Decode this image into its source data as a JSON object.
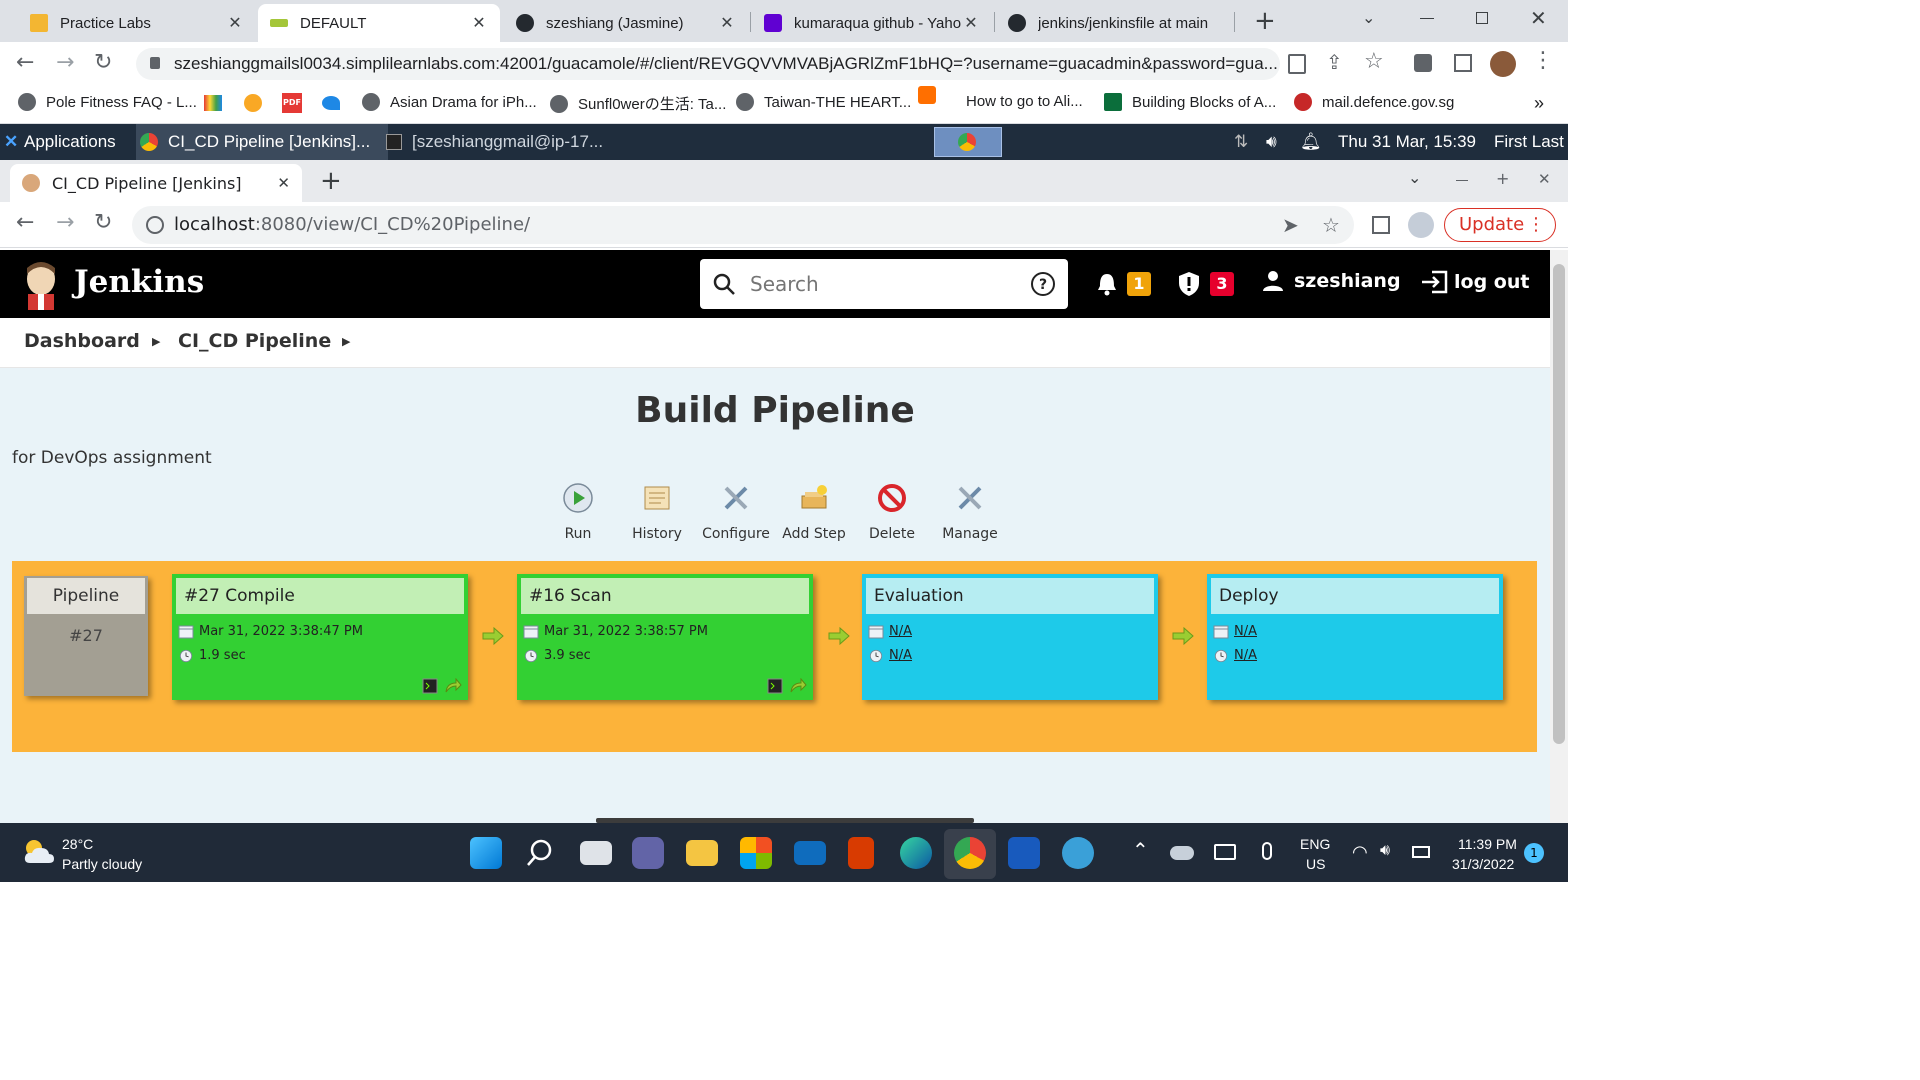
{
  "outer_browser": {
    "tabs": [
      {
        "label": "Practice Labs",
        "active": false
      },
      {
        "label": "DEFAULT",
        "active": true
      },
      {
        "label": "szeshiang (Jasmine)",
        "active": false
      },
      {
        "label": "kumaraqua github - Yaho",
        "active": false
      },
      {
        "label": "jenkins/jenkinsfile at main",
        "active": false
      }
    ],
    "new_tab": "+",
    "close": "✕",
    "url": "szeshianggmailsl0034.simplilearnlabs.com:42001/guacamole/#/client/REVGQVVMVABjAGRlZmF1bHQ=?username=guacadmin&password=gua...",
    "bookmarks": [
      "Pole Fitness FAQ - L...",
      "Asian Drama for iPh...",
      "Sunfl0werの生活: Ta...",
      "Taiwan-THE HEART...",
      "How to go to Ali...",
      "Building Blocks of A...",
      "mail.defence.gov.sg"
    ],
    "bookmarks_more": "»"
  },
  "remote_desktop": {
    "applications": "Applications",
    "task1": "CI_CD Pipeline [Jenkins]...",
    "task2": "[szeshianggmail@ip-17...",
    "clock": "Thu 31 Mar, 15:39",
    "user": "First Last"
  },
  "inner_browser": {
    "tab_title": "CI_CD Pipeline [Jenkins]",
    "url_host": "localhost",
    "url_path": ":8080/view/CI_CD%20Pipeline/",
    "update_label": "Update"
  },
  "jenkins": {
    "title": "Jenkins",
    "search_placeholder": "Search",
    "notifications_count": "1",
    "security_count": "3",
    "username": "szeshiang",
    "logout": "log out",
    "breadcrumb": [
      "Dashboard",
      "CI_CD Pipeline"
    ],
    "page_title": "Build Pipeline",
    "description": "for DevOps assignment",
    "tools": [
      {
        "label": "Run",
        "icon": "run-icon"
      },
      {
        "label": "History",
        "icon": "history-icon"
      },
      {
        "label": "Configure",
        "icon": "configure-icon"
      },
      {
        "label": "Add Step",
        "icon": "add-step-icon"
      },
      {
        "label": "Delete",
        "icon": "delete-icon"
      },
      {
        "label": "Manage",
        "icon": "manage-icon"
      }
    ],
    "pipeline": {
      "label": "Pipeline",
      "number": "#27"
    },
    "stages": [
      {
        "name": "#27 Compile",
        "date": "Mar 31, 2022 3:38:47 PM",
        "duration": "1.9 sec",
        "status": "success"
      },
      {
        "name": "#16 Scan",
        "date": "Mar 31, 2022 3:38:57 PM",
        "duration": "3.9 sec",
        "status": "success"
      },
      {
        "name": "Evaluation",
        "date": "N/A",
        "duration": "N/A",
        "status": "pending"
      },
      {
        "name": "Deploy",
        "date": "N/A",
        "duration": "N/A",
        "status": "pending"
      }
    ],
    "colors": {
      "success": "#33d033",
      "pending": "#1ecae9",
      "pipeline_bg": "#fcb33a"
    }
  },
  "taskbar": {
    "temperature": "28°C",
    "weather": "Partly cloudy",
    "lang1": "ENG",
    "lang2": "US",
    "time": "11:39 PM",
    "date": "31/3/2022",
    "notification_count": "1"
  }
}
